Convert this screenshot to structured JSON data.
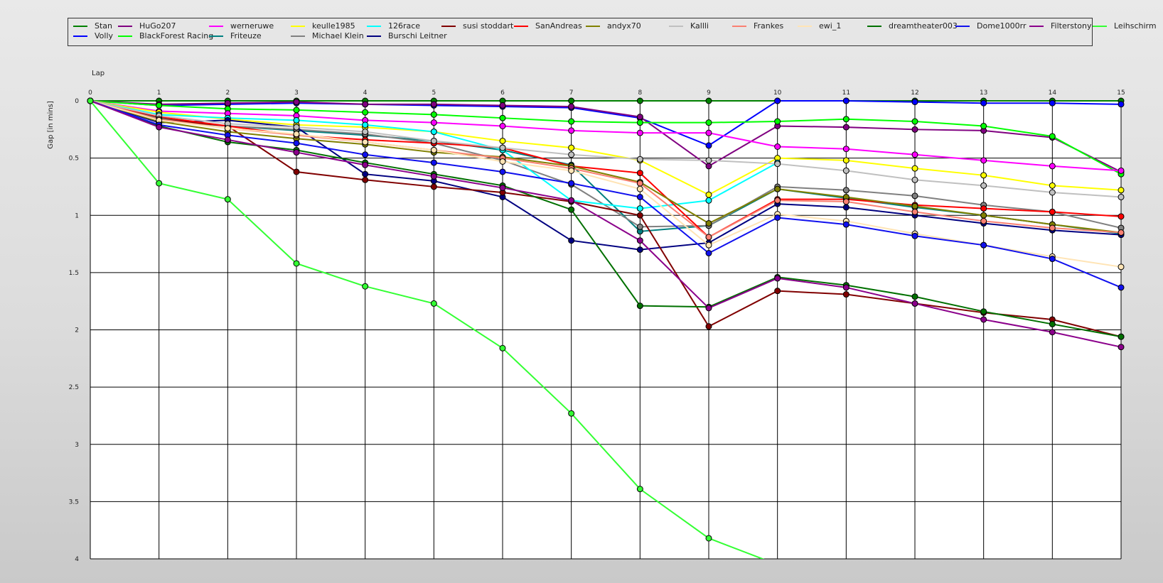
{
  "chart_data": {
    "type": "line",
    "xlabel": "Lap",
    "ylabel": "Gap [in mins]",
    "x": [
      0,
      1,
      2,
      3,
      4,
      5,
      6,
      7,
      8,
      9,
      10,
      11,
      12,
      13,
      14,
      15
    ],
    "xlim": [
      0,
      15
    ],
    "ylim": [
      0,
      4
    ],
    "y_inverted": true,
    "yticks": [
      "0",
      "0.5",
      "1",
      "1.5",
      "2",
      "2.5",
      "3",
      "3.5",
      "4"
    ],
    "grid": true,
    "legend_position": "top",
    "series": [
      {
        "name": "Stan",
        "color": "#008000",
        "values": [
          0,
          0,
          0,
          0,
          0,
          0,
          0,
          0,
          0,
          0,
          0,
          0,
          0,
          0,
          0,
          0
        ]
      },
      {
        "name": "Volly",
        "color": "#0000ff",
        "values": [
          0,
          0.04,
          0.03,
          0.02,
          0.03,
          0.04,
          0.05,
          0.06,
          0.15,
          0.39,
          0,
          0,
          0.01,
          0.02,
          0.02,
          0.03
        ]
      },
      {
        "name": "HuGo207",
        "color": "#800080",
        "values": [
          0,
          0.03,
          0.02,
          0.01,
          0.03,
          0.03,
          0.04,
          0.05,
          0.14,
          0.57,
          0.22,
          0.23,
          0.25,
          0.26,
          0.32,
          0.62
        ]
      },
      {
        "name": "BlackForest Racing",
        "color": "#00ff00",
        "values": [
          0,
          0.04,
          0.07,
          0.08,
          0.1,
          0.12,
          0.15,
          0.18,
          0.19,
          0.19,
          0.18,
          0.16,
          0.18,
          0.22,
          0.31,
          0.64
        ]
      },
      {
        "name": "werneruwe",
        "color": "#ff00ff",
        "values": [
          0,
          0.09,
          0.11,
          0.13,
          0.17,
          0.19,
          0.22,
          0.26,
          0.28,
          0.28,
          0.4,
          0.42,
          0.47,
          0.52,
          0.57,
          0.61
        ]
      },
      {
        "name": "Friteuze",
        "color": "#008080",
        "values": [
          0,
          0.15,
          0.22,
          0.26,
          0.3,
          0.35,
          0.43,
          0.56,
          1.14,
          1.09,
          0.77,
          0.85,
          0.93,
          1,
          1.08,
          1.16
        ]
      },
      {
        "name": "keulle1985",
        "color": "#ffff00",
        "values": [
          0,
          0.1,
          0.16,
          0.21,
          0.23,
          0.27,
          0.35,
          0.41,
          0.52,
          0.82,
          0.5,
          0.52,
          0.59,
          0.65,
          0.74,
          0.78
        ]
      },
      {
        "name": "Michael Klein",
        "color": "#808080",
        "values": [
          0,
          0.17,
          0.22,
          0.25,
          0.29,
          0.37,
          0.52,
          0.73,
          1.1,
          1.09,
          0.75,
          0.78,
          0.83,
          0.91,
          0.97,
          1.11
        ]
      },
      {
        "name": "126race",
        "color": "#00ffff",
        "values": [
          0,
          0.12,
          0.15,
          0.17,
          0.21,
          0.27,
          0.43,
          0.87,
          0.94,
          0.87,
          0.54,
          null,
          null,
          null,
          null,
          null
        ]
      },
      {
        "name": "Burschi Leitner",
        "color": "#000080",
        "values": [
          0,
          0.19,
          0.17,
          0.23,
          0.64,
          0.7,
          0.84,
          1.22,
          1.3,
          1.24,
          0.9,
          0.93,
          1,
          1.07,
          1.13,
          1.17
        ]
      },
      {
        "name": "susi stoddart",
        "color": "#800000",
        "values": [
          0,
          0.16,
          0.22,
          0.62,
          0.69,
          0.75,
          0.8,
          0.88,
          1,
          1.97,
          1.66,
          1.69,
          1.77,
          1.85,
          1.91,
          2.06
        ]
      },
      {
        "name": "SanAndreas",
        "color": "#ff0000",
        "values": [
          0,
          0.14,
          0.22,
          0.3,
          0.34,
          0.37,
          0.41,
          0.57,
          0.63,
          1.19,
          0.86,
          0.86,
          0.91,
          0.94,
          0.97,
          1.01
        ]
      },
      {
        "name": "andyx70",
        "color": "#808000",
        "values": [
          0,
          0.18,
          0.27,
          0.33,
          0.38,
          0.45,
          0.49,
          0.57,
          0.71,
          1.07,
          0.77,
          0.84,
          0.92,
          1,
          1.08,
          1.15
        ]
      },
      {
        "name": "Kallli",
        "color": "#c0c0c0",
        "values": [
          0,
          0.13,
          0.2,
          0.23,
          0.27,
          0.35,
          0.41,
          0.47,
          0.51,
          0.52,
          0.55,
          0.61,
          0.69,
          0.74,
          0.8,
          0.84
        ]
      },
      {
        "name": "Frankes",
        "color": "#fa8072",
        "values": [
          0,
          0.16,
          0.24,
          0.3,
          0.36,
          0.43,
          0.5,
          0.59,
          0.72,
          1.19,
          0.87,
          0.88,
          0.97,
          1.05,
          1.11,
          1.15
        ]
      },
      {
        "name": "ewi_1",
        "color": "#ffe4b5",
        "values": [
          0,
          0.17,
          0.24,
          0.29,
          0.36,
          0.43,
          0.53,
          0.61,
          0.77,
          1.26,
          0.99,
          1.05,
          1.16,
          1.26,
          1.36,
          1.45
        ]
      },
      {
        "name": "dreamtheater003",
        "color": "#007000",
        "values": [
          0,
          0.22,
          0.36,
          0.43,
          0.54,
          0.64,
          0.74,
          0.95,
          1.79,
          1.8,
          1.54,
          1.61,
          1.71,
          1.84,
          1.95,
          2.06
        ]
      },
      {
        "name": "Dome1000rr",
        "color": "#1010ee",
        "values": [
          0,
          0.21,
          0.3,
          0.37,
          0.47,
          0.54,
          0.62,
          0.72,
          0.84,
          1.33,
          1.02,
          1.08,
          1.18,
          1.26,
          1.38,
          1.63
        ]
      },
      {
        "name": "Filterstony",
        "color": "#8b008b",
        "values": [
          0,
          0.23,
          0.34,
          0.45,
          0.56,
          0.66,
          0.76,
          0.87,
          1.22,
          1.81,
          1.55,
          1.63,
          1.77,
          1.91,
          2.02,
          2.15
        ]
      },
      {
        "name": "Leihschirm",
        "color": "#33ff33",
        "values": [
          0,
          0.72,
          0.86,
          1.42,
          1.62,
          1.77,
          2.16,
          2.73,
          3.39,
          3.82,
          4.05,
          null,
          null,
          null,
          null,
          null
        ]
      }
    ],
    "legend_rows": [
      [
        "Stan",
        "HuGo207",
        "werneruwe",
        "keulle1985",
        "126race",
        "susi stoddart",
        "SanAndreas",
        "andyx70",
        "Kallli",
        "Frankes",
        "ewi_1",
        "dreamtheater003",
        "Dome1000rr",
        "Filterstony",
        "Leihschirm"
      ],
      [
        "Volly",
        "BlackForest Racing",
        "Friteuze",
        "Michael Klein",
        "Burschi Leitner"
      ]
    ]
  }
}
